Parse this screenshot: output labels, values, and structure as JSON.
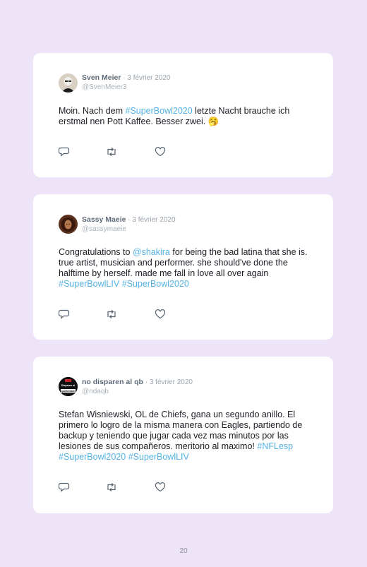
{
  "tweets": [
    {
      "name": "Sven Meier",
      "date": "· 3 février 2020",
      "handle": "@SvenMeier3",
      "text": [
        {
          "t": "Moin. Nach dem "
        },
        {
          "t": "#SuperBowl2020",
          "tag": true
        },
        {
          "t": " letzte Nacht brauche ich erstmal nen Pott Kaffee. Besser zwei. 🥱"
        }
      ]
    },
    {
      "name": "Sassy Maeie",
      "date": "· 3 février 2020",
      "handle": "@sassymaeie",
      "text": [
        {
          "t": "Congratulations to "
        },
        {
          "t": "@shakira",
          "tag": true
        },
        {
          "t": " for being the bad latina that she is. true artist, musician and performer. she should've done the halftime by herself. made me fall in love all over again "
        },
        {
          "t": "#SuperBowlLIV",
          "tag": true
        },
        {
          "t": " "
        },
        {
          "t": "#SuperBowl2020",
          "tag": true
        }
      ]
    },
    {
      "name": "no disparen al qb",
      "date": "· 3 février 2020",
      "handle": "@ndaqb",
      "avatar_text": "Disparen al quarterback",
      "text": [
        {
          "t": "Stefan Wisniewski, OL de Chiefs, gana un segundo anillo. El primero lo logro de la misma manera con Eagles, partiendo de backup y teniendo que jugar cada vez mas minutos por las lesiones de sus compañeros. meritorio al maximo! "
        },
        {
          "t": "#NFLesp",
          "tag": true
        },
        {
          "t": " "
        },
        {
          "t": "#SuperBowl2020",
          "tag": true
        },
        {
          "t": " "
        },
        {
          "t": "#SuperBowlLIV",
          "tag": true
        }
      ]
    }
  ],
  "page_number": "20",
  "colors": {
    "background": "#ede4f7",
    "hashtag": "#53b1e6"
  },
  "icons": [
    "reply-icon",
    "retweet-icon",
    "like-icon"
  ]
}
